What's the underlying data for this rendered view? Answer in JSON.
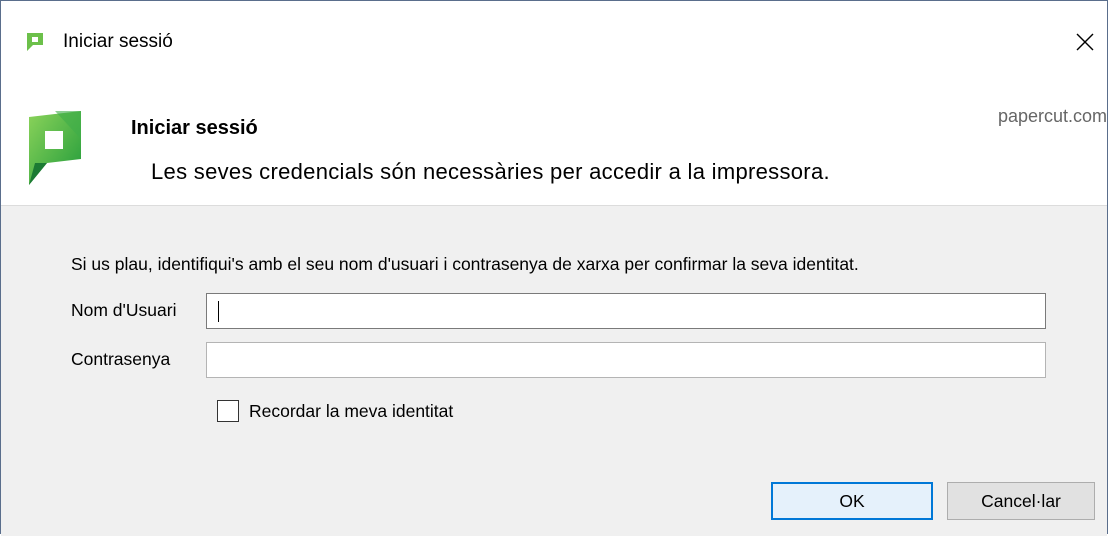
{
  "window": {
    "title": "Iniciar sessió",
    "close_label": "×"
  },
  "header": {
    "title": "Iniciar sessió",
    "subtitle": "Les seves credencials són necessàries per accedir a la impressora.",
    "brand": "papercut.com"
  },
  "form": {
    "instructions": "Si us plau, identifiqui's amb el seu nom d'usuari i contrasenya de xarxa per confirmar la seva identitat.",
    "username_label": "Nom d'Usuari",
    "username_value": "",
    "password_label": "Contrasenya",
    "password_value": "",
    "remember_label": "Recordar la meva identitat",
    "remember_checked": false
  },
  "buttons": {
    "ok_label": "OK",
    "cancel_label": "Cancel·lar"
  },
  "colors": {
    "accent": "#0078d7",
    "logo_green": "#6cc04a",
    "logo_dark": "#2e7d32"
  }
}
